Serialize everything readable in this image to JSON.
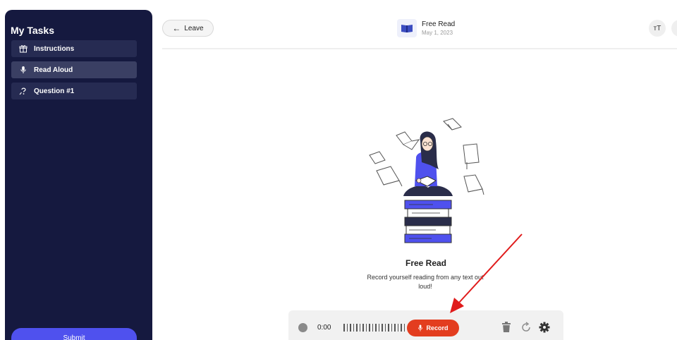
{
  "sidebar": {
    "title": "My Tasks",
    "items": [
      {
        "label": "Instructions",
        "icon": "gift-icon",
        "active": false
      },
      {
        "label": "Read Aloud",
        "icon": "microphone-icon",
        "active": true
      },
      {
        "label": "Question #1",
        "icon": "question-icon",
        "active": false
      }
    ],
    "submit_label": "Submit"
  },
  "header": {
    "leave_label": "Leave",
    "title": "Free Read",
    "date": "May 1, 2023",
    "text_size_label": "тT"
  },
  "main": {
    "title": "Free Read",
    "description": "Record yourself reading from any text out loud!"
  },
  "recorder": {
    "time": "0:00",
    "record_label": "Record"
  },
  "colors": {
    "sidebar_bg": "#15193f",
    "accent": "#4f51ee",
    "record": "#e33d1f",
    "annotation_arrow": "#e01b1b"
  }
}
